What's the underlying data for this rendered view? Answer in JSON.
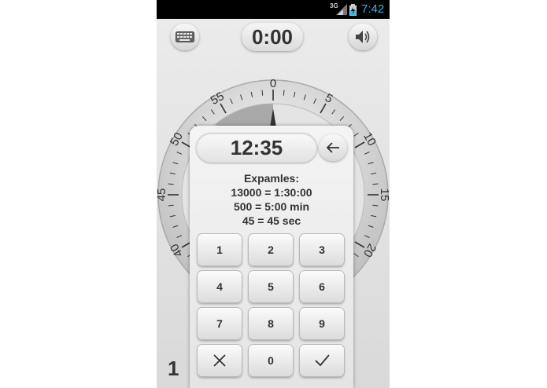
{
  "status_bar": {
    "network": "3G",
    "time": "7:42"
  },
  "header": {
    "timer": "0:00"
  },
  "dial": {
    "labels": [
      "0",
      "5",
      "10",
      "15",
      "20",
      "40",
      "45",
      "50",
      "55"
    ]
  },
  "footer": {
    "count": "1"
  },
  "dialog": {
    "input_value": "12:35",
    "examples": [
      "Expamles:",
      "13000 = 1:30:00",
      "500 = 5:00 min",
      "45 = 45 sec"
    ],
    "keys": [
      "1",
      "2",
      "3",
      "4",
      "5",
      "6",
      "7",
      "8",
      "9",
      "",
      "0",
      ""
    ]
  },
  "icons": {
    "keyboard": "keyboard-icon",
    "sound": "speaker-icon",
    "backspace": "back-arrow-icon",
    "clear": "close-icon",
    "confirm": "check-icon"
  },
  "colors": {
    "status_time": "#33b5e5",
    "status_bar": "#000000"
  }
}
